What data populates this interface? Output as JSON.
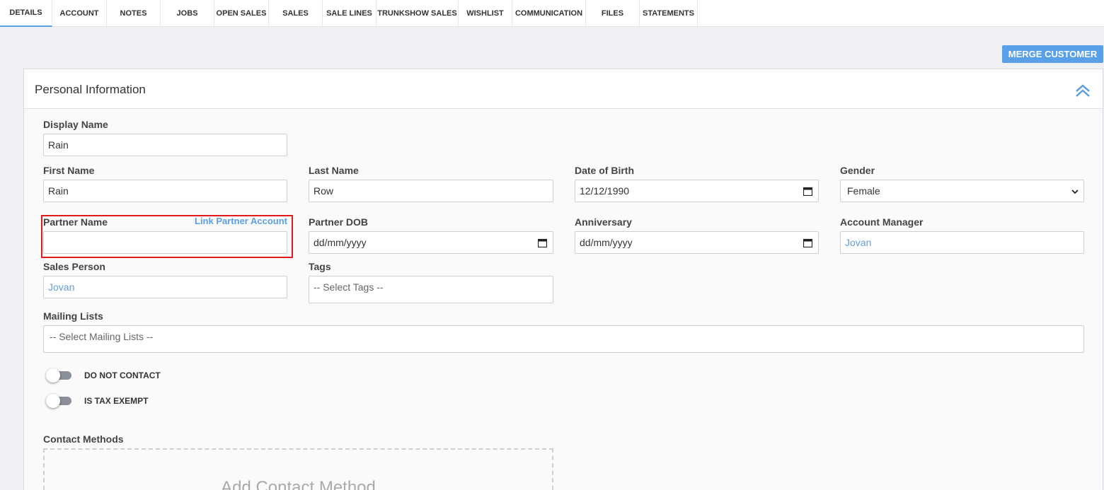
{
  "tabs": [
    {
      "label": "DETAILS",
      "active": true
    },
    {
      "label": "ACCOUNT"
    },
    {
      "label": "NOTES"
    },
    {
      "label": "JOBS"
    },
    {
      "label": "OPEN SALES"
    },
    {
      "label": "SALES"
    },
    {
      "label": "SALE LINES"
    },
    {
      "label": "TRUNKSHOW SALES"
    },
    {
      "label": "WISHLIST"
    },
    {
      "label": "COMMUNICATION"
    },
    {
      "label": "FILES"
    },
    {
      "label": "STATEMENTS"
    }
  ],
  "merge_button": "MERGE CUSTOMER",
  "panel": {
    "title": "Personal Information",
    "collapse_icon": "chevrons-up-icon"
  },
  "form": {
    "display_name": {
      "label": "Display Name",
      "value": "Rain"
    },
    "first_name": {
      "label": "First Name",
      "value": "Rain"
    },
    "last_name": {
      "label": "Last Name",
      "value": "Row"
    },
    "dob": {
      "label": "Date of Birth",
      "value": "12/12/1990"
    },
    "gender": {
      "label": "Gender",
      "value": "Female"
    },
    "partner_name": {
      "label": "Partner Name",
      "value": "",
      "link": "Link Partner Account"
    },
    "partner_dob": {
      "label": "Partner DOB",
      "value": "dd/mm/yyyy"
    },
    "anniversary": {
      "label": "Anniversary",
      "value": "dd/mm/yyyy"
    },
    "account_manager": {
      "label": "Account Manager",
      "value": "Jovan"
    },
    "sales_person": {
      "label": "Sales Person",
      "value": "Jovan"
    },
    "tags": {
      "label": "Tags",
      "placeholder": "-- Select Tags --"
    },
    "mailing_lists": {
      "label": "Mailing Lists",
      "placeholder": "-- Select Mailing Lists --"
    }
  },
  "toggles": {
    "do_not_contact": {
      "label": "DO NOT CONTACT",
      "on": false
    },
    "tax_exempt": {
      "label": "IS TAX EXEMPT",
      "on": false
    }
  },
  "contact": {
    "label": "Contact Methods",
    "add_text": "Add Contact Method"
  },
  "colors": {
    "accent": "#5aa0e0",
    "highlight": "#e01b1b"
  }
}
